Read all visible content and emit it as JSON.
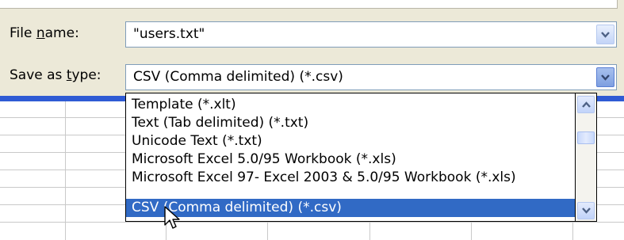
{
  "dialog": {
    "file_name": {
      "label_prefix": "File ",
      "label_mnemonic": "n",
      "label_suffix": "ame:",
      "value": "\"users.txt\""
    },
    "save_as_type": {
      "label_prefix": "Save as ",
      "label_mnemonic": "t",
      "label_suffix": "ype:",
      "value": "CSV (Comma delimited) (*.csv)"
    }
  },
  "type_list": {
    "items": [
      "Template (*.xlt)",
      "Text (Tab delimited) (*.txt)",
      "Unicode Text (*.txt)",
      "Microsoft Excel 5.0/95 Workbook (*.xls)",
      "Microsoft Excel 97- Excel 2003 & 5.0/95 Workbook (*.xls)",
      "CSV (Comma delimited) (*.csv)"
    ],
    "selected_index": 5
  },
  "icons": {
    "dropdown": "chevron-down-icon",
    "scroll_up": "chevron-up-icon",
    "scroll_down": "chevron-down-icon",
    "pointer": "mouse-pointer-icon"
  },
  "colors": {
    "selection": "#316ac5",
    "title_bar": "#2f5bd4",
    "dialog_bg": "#ece9d8"
  }
}
